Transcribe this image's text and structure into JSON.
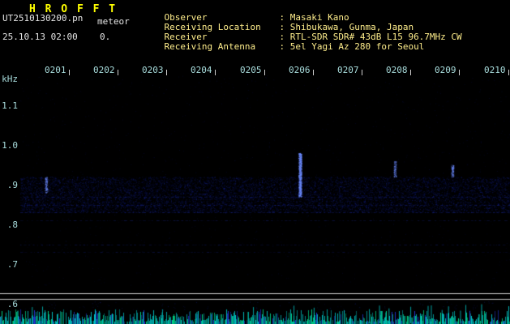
{
  "header": {
    "logo": "H R O F F T",
    "filename": "UT2510130200.pn",
    "filename_suffix": "meteor",
    "datetime": "25.10.13 02:00",
    "counter": "0.",
    "info": [
      {
        "label": "Observer",
        "value": ": Masaki Kano"
      },
      {
        "label": "Receiving Location",
        "value": ": Shibukawa, Gunma, Japan"
      },
      {
        "label": "Receiver",
        "value": ": RTL-SDR SDR# 43dB L15 96.7MHz CW"
      },
      {
        "label": "Receiving Antenna",
        "value": ": 5el Yagi Az 280 for Seoul"
      }
    ]
  },
  "chart_data": {
    "type": "heatmap",
    "title": "HROFFT 10-minute meteor radio echo spectrogram with signal-level strip",
    "x_ticks": [
      "0201",
      "0202",
      "0203",
      "0204",
      "0205",
      "0206",
      "0207",
      "0208",
      "0209",
      "0210"
    ],
    "x_range_ut": [
      "0200",
      "0210"
    ],
    "y_unit": "kHz",
    "y_ticks": [
      "1.1",
      "1.0",
      ".9",
      ".8",
      ".7",
      ".6"
    ],
    "y_range_khz": [
      0.6,
      1.15
    ],
    "grid": "off",
    "noise_band_khz": [
      0.83,
      0.92
    ],
    "h_lines_khz": [
      0.87,
      0.85,
      0.83,
      0.81,
      0.75,
      0.73
    ],
    "events": [
      {
        "time": "0200.5",
        "x": 57,
        "khz_from": 0.88,
        "khz_to": 0.92,
        "intensity": "faint"
      },
      {
        "time": "0205.7",
        "x": 370,
        "khz_from": 0.87,
        "khz_to": 0.98,
        "intensity": "bright"
      },
      {
        "time": "0207.6",
        "x": 487,
        "khz_from": 0.92,
        "khz_to": 0.96,
        "intensity": "faint"
      },
      {
        "time": "0208.8",
        "x": 558,
        "khz_from": 0.92,
        "khz_to": 0.95,
        "intensity": "faint"
      }
    ],
    "level_plot": {
      "baseline_lines_y": [
        362,
        369
      ]
    }
  },
  "colors": {
    "background": "#000000",
    "logo": "#ffff00",
    "header_info": "#ffee8c",
    "header_left": "#e6e6e6",
    "axis_labels": "#a8dcdc",
    "noise_blue": "#2337d7",
    "echo_blue": "#6e8cff",
    "level_noise": "#00c8c8",
    "level_noise_green": "#00dc8c",
    "baseline_white": "#e1e1e1"
  }
}
